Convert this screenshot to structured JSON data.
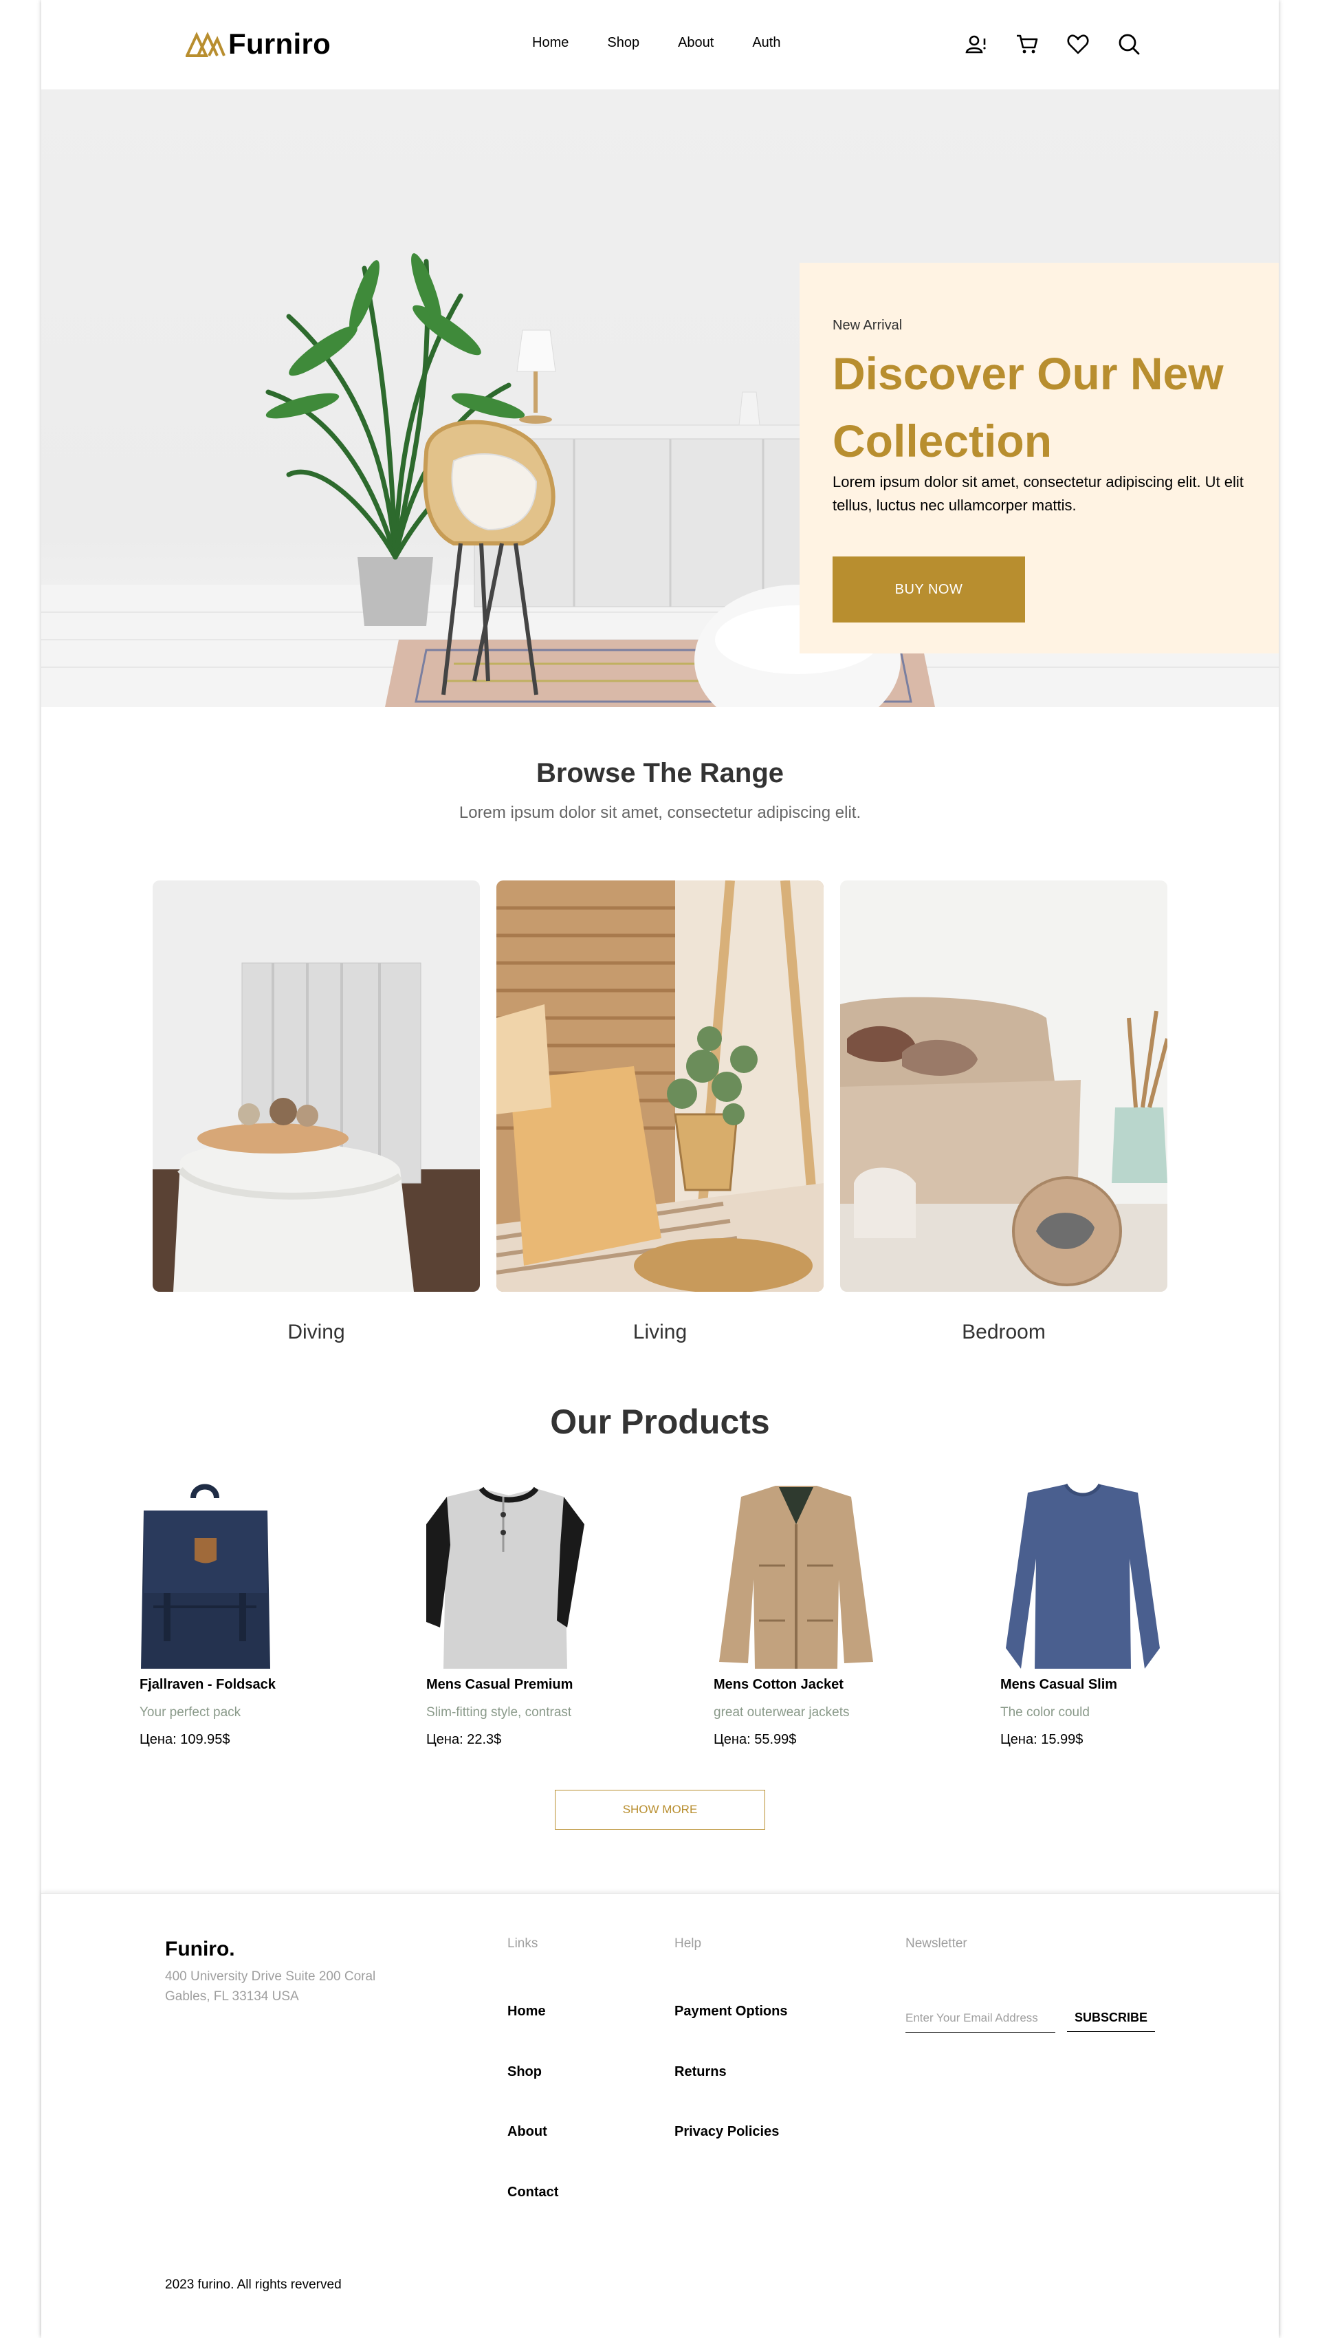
{
  "header": {
    "brand": "Furniro",
    "nav": [
      "Home",
      "Shop",
      "About",
      "Auth"
    ],
    "icons": [
      "user-alert-icon",
      "cart-icon",
      "heart-icon",
      "search-icon"
    ]
  },
  "hero": {
    "eyebrow": "New Arrival",
    "title": "Discover Our New Collection",
    "description": "Lorem ipsum dolor sit amet, consectetur adipiscing elit. Ut elit tellus, luctus nec ullamcorper mattis.",
    "button": "BUY NOW"
  },
  "browse": {
    "title": "Browse The Range",
    "subtitle": "Lorem ipsum dolor sit amet, consectetur adipiscing elit.",
    "items": [
      {
        "label": "Diving"
      },
      {
        "label": "Living"
      },
      {
        "label": "Bedroom"
      }
    ]
  },
  "products": {
    "title": "Our Products",
    "items": [
      {
        "name": "Fjallraven - Foldsack",
        "desc": "Your perfect pack",
        "price": "Цена: 109.95$"
      },
      {
        "name": "Mens Casual Premium",
        "desc": "Slim-fitting style, contrast",
        "price": "Цена: 22.3$"
      },
      {
        "name": "Mens Cotton Jacket",
        "desc": "great outerwear jackets",
        "price": "Цена: 55.99$"
      },
      {
        "name": "Mens Casual Slim",
        "desc": "The color could",
        "price": "Цена: 15.99$"
      }
    ],
    "show_more": "SHOW MORE"
  },
  "footer": {
    "brand": "Funiro.",
    "address": "400 University Drive Suite 200 Coral Gables, FL 33134 USA",
    "links_heading": "Links",
    "links": [
      "Home",
      "Shop",
      "About",
      "Contact"
    ],
    "help_heading": "Help",
    "help": [
      "Payment Options",
      "Returns",
      "Privacy Policies"
    ],
    "newsletter_heading": "Newsletter",
    "email_placeholder": "Enter Your Email Address",
    "subscribe": "SUBSCRIBE",
    "copyright": "2023 furino. All rights reverved"
  },
  "colors": {
    "accent": "#b88e2f",
    "hero_card": "#fff3e3",
    "text": "#333333",
    "muted": "#9f9f9f"
  }
}
